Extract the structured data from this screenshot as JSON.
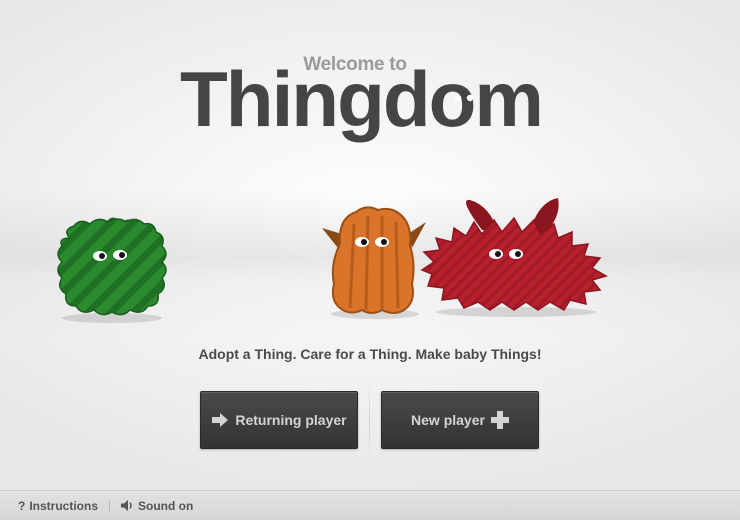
{
  "header": {
    "welcome_text": "Welcome to",
    "logo_text": "Thingdom"
  },
  "tagline": "Adopt a Thing. Care for a Thing. Make baby Things!",
  "buttons": {
    "returning_label": "Returning player",
    "returning_icon": "arrow-right-icon",
    "new_label": "New player",
    "new_icon": "plus-icon"
  },
  "footer": {
    "instructions_label": "Instructions",
    "instructions_icon": "question-mark",
    "sound_label": "Sound on",
    "sound_icon": "speaker-icon"
  },
  "creatures": [
    {
      "name": "green-fluffy-thing",
      "color": "#2e8b2e"
    },
    {
      "name": "orange-horned-thing",
      "color": "#d9742a"
    },
    {
      "name": "red-spiky-thing",
      "color": "#b8202e"
    }
  ],
  "colors": {
    "logo": "#454545",
    "welcome": "#9a9a9a",
    "button_bg": "#3a3a3a",
    "button_text": "#d4d4d4"
  }
}
